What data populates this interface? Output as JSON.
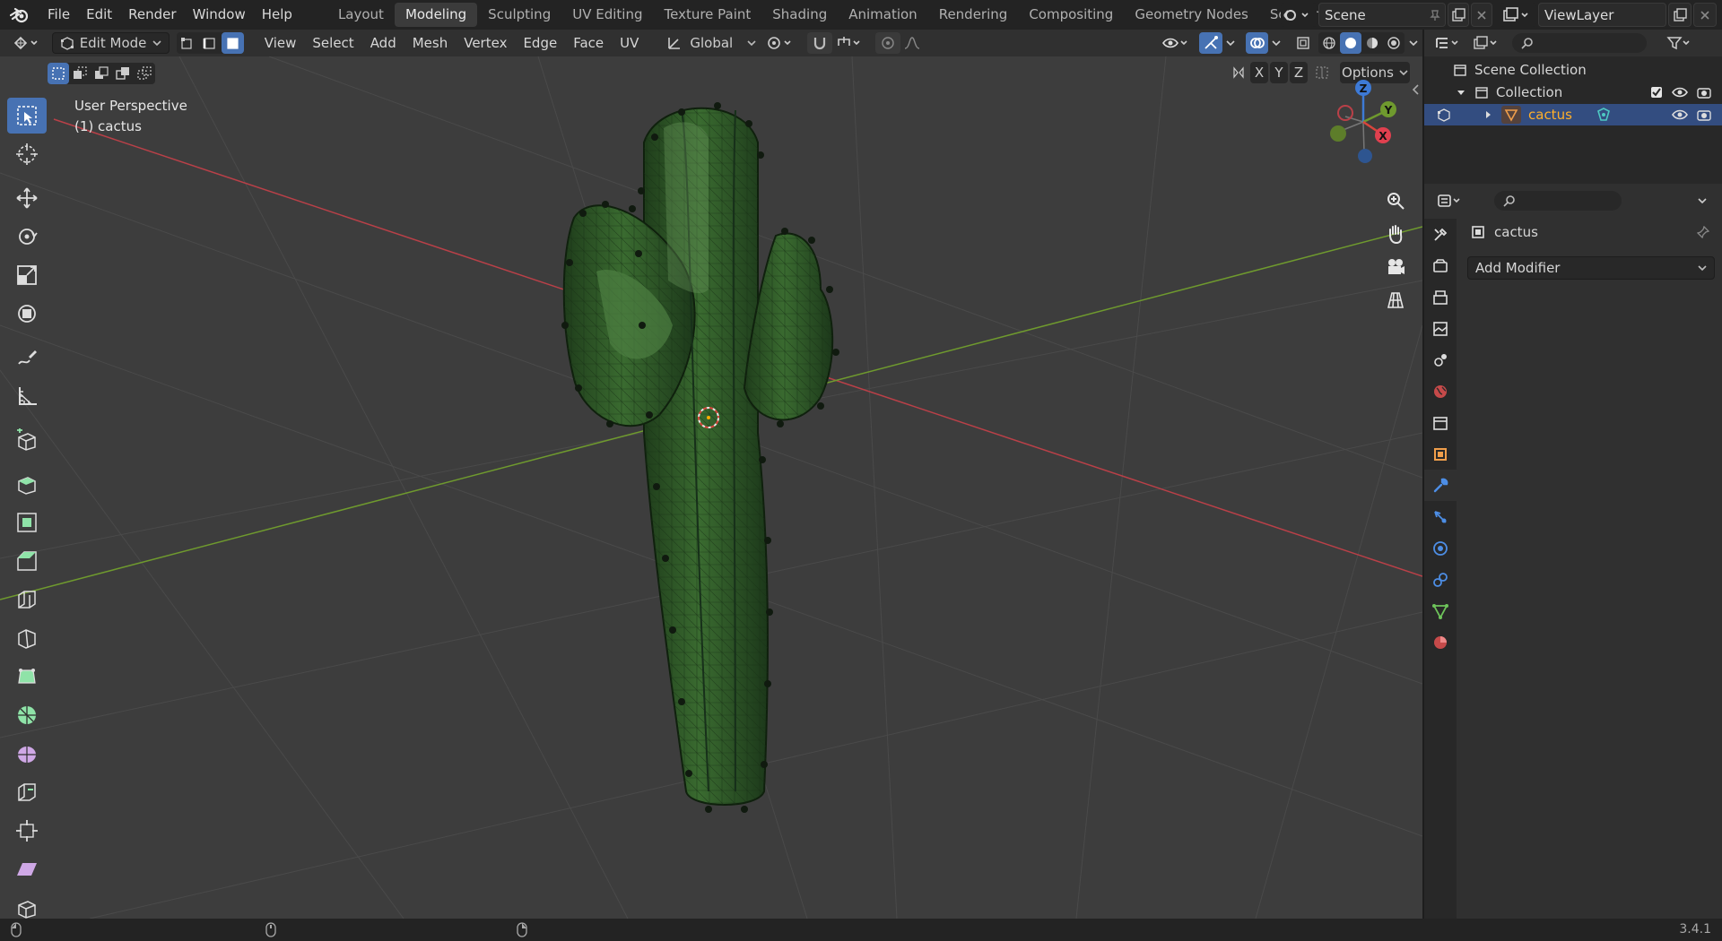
{
  "app": {
    "version": "3.4.1"
  },
  "menu": [
    "File",
    "Edit",
    "Render",
    "Window",
    "Help"
  ],
  "workspaces": [
    "Layout",
    "Modeling",
    "Sculpting",
    "UV Editing",
    "Texture Paint",
    "Shading",
    "Animation",
    "Rendering",
    "Compositing",
    "Geometry Nodes",
    "Scripting"
  ],
  "active_workspace": "Modeling",
  "scene": {
    "name": "Scene"
  },
  "view_layer": {
    "name": "ViewLayer"
  },
  "header": {
    "mode": "Edit Mode",
    "menus": [
      "View",
      "Select",
      "Add",
      "Mesh",
      "Vertex",
      "Edge",
      "Face",
      "UV"
    ],
    "orientation": "Global",
    "options_label": "Options",
    "axes": [
      "X",
      "Y",
      "Z"
    ]
  },
  "viewport": {
    "perspective_label": "User Perspective",
    "object_label": "(1) cactus",
    "background_color": "#3d3d3d",
    "gizmo_axes": [
      "Z",
      "Y",
      "X"
    ]
  },
  "outliner": {
    "scene_collection": "Scene Collection",
    "collection": "Collection",
    "object": "cactus"
  },
  "properties": {
    "object_name": "cactus",
    "add_modifier_label": "Add Modifier"
  },
  "colors": {
    "accent": "#4772b3",
    "x_axis": "#b94048",
    "y_axis": "#6f9a2e",
    "z_axis": "#3d7ad6",
    "cactus": "#2f5a27",
    "selected_name": "#ffaf29"
  }
}
